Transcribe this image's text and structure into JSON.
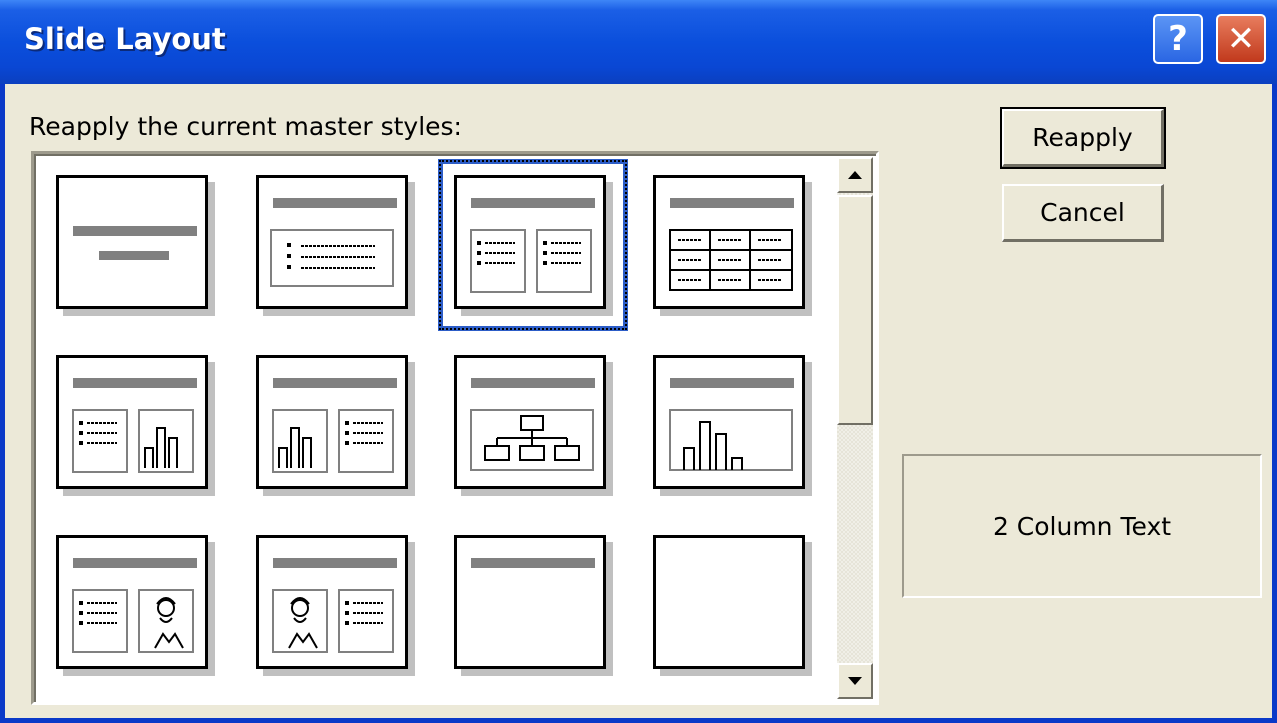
{
  "window": {
    "title": "Slide Layout",
    "help_label": "?",
    "close_label": "✕"
  },
  "caption": "Reapply the current master styles:",
  "buttons": {
    "reapply": "Reapply",
    "cancel": "Cancel"
  },
  "preview": {
    "label": "2 Column Text"
  },
  "layouts": [
    {
      "id": "title-slide",
      "icon": "title-slide-layout-icon"
    },
    {
      "id": "bulleted-list",
      "icon": "bulleted-list-layout-icon"
    },
    {
      "id": "2-column-text",
      "icon": "two-column-text-layout-icon",
      "selected": true
    },
    {
      "id": "table",
      "icon": "table-layout-icon"
    },
    {
      "id": "text-and-chart",
      "icon": "text-and-chart-layout-icon"
    },
    {
      "id": "chart-and-text",
      "icon": "chart-and-text-layout-icon"
    },
    {
      "id": "organization-chart",
      "icon": "organization-chart-layout-icon"
    },
    {
      "id": "chart",
      "icon": "chart-layout-icon"
    },
    {
      "id": "text-and-clip-art",
      "icon": "text-and-clip-art-layout-icon"
    },
    {
      "id": "clip-art-and-text",
      "icon": "clip-art-and-text-layout-icon"
    },
    {
      "id": "title-only",
      "icon": "title-only-layout-icon"
    },
    {
      "id": "blank",
      "icon": "blank-layout-icon"
    }
  ],
  "colors": {
    "title_bar": "#0b4fdc",
    "selection": "#2d5dc7",
    "dialog_face": "#ece9d8"
  }
}
